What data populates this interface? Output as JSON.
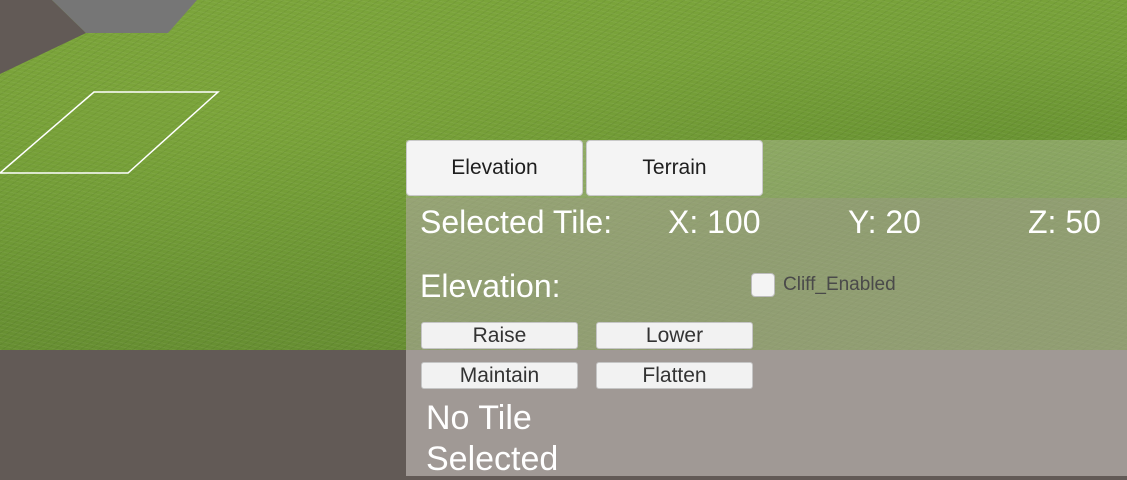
{
  "tabs": [
    {
      "label": "Elevation"
    },
    {
      "label": "Terrain"
    }
  ],
  "selected_tile": {
    "label": "Selected Tile:",
    "x": "X: 100",
    "y": "Y: 20",
    "z": "Z: 50"
  },
  "elevation": {
    "label": "Elevation:",
    "cliff_label": "Cliff_Enabled",
    "cliff_checked": false,
    "buttons": {
      "raise": "Raise",
      "lower": "Lower",
      "maintain": "Maintain",
      "flatten": "Flatten"
    }
  },
  "status": {
    "line1": "No Tile",
    "line2": "Selected"
  },
  "colors": {
    "grass": "#6f9a37",
    "void": "#625a56",
    "stone": "#757575",
    "selection_outline": "#ffffff"
  }
}
